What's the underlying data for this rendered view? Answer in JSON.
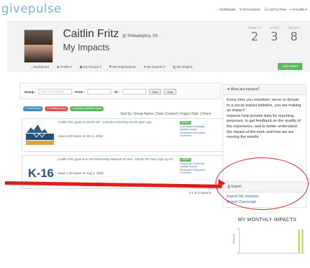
{
  "app": {
    "logo": "givepulse"
  },
  "topnav": {
    "items": [
      {
        "icon": "home-icon",
        "label": "Dashboard"
      },
      {
        "icon": "search-icon",
        "label": "Get Involved"
      },
      {
        "icon": "list-icon",
        "label": "List For Free"
      },
      {
        "icon": "avatar",
        "label": "Hi Caitlin"
      }
    ]
  },
  "profile": {
    "name": "Caitlin Fritz",
    "location": "@ Philadelphia, PA",
    "subtitle": "My Impacts"
  },
  "stats": [
    {
      "label": "IMPACTS",
      "value": "2"
    },
    {
      "label": "HOURS",
      "value": "3"
    },
    {
      "label": "GROUPS",
      "value": "8"
    }
  ],
  "nav": {
    "items": [
      "Dashboard",
      "Profile",
      "My Groups",
      "My Registrations",
      "My Impacts",
      "My Insights"
    ],
    "add_impact": "Add Impact"
  },
  "filter": {
    "group_label": "Group :",
    "group_placeholder": "Select Some Options",
    "from_label": "From :",
    "to_label": "To :",
    "filter_button": "Filter",
    "clear_button": "Clear"
  },
  "badges": [
    {
      "label": "3 Total Hours",
      "color": "#3a8fc0"
    },
    {
      "label": "0 Verified Hours",
      "color": "#d9534f"
    },
    {
      "label": "3 Network Verified Hours",
      "color": "#5cb85c"
    }
  ],
  "sort": {
    "text": "Sort by: Group Name | Date Created | Impact Date | Hours"
  },
  "impacts": [
    {
      "title": "Caitlin Fritz gave to GEAR UP - LaSalle University at test open opp",
      "given": "Gave 2.00 hours on Oct 4, 2016",
      "verified": "Verified",
      "actions": [
        "Download Certificate",
        "Update Impact",
        "Verification Requests",
        "Comment"
      ]
    },
    {
      "title": "Caitlin Fritz gave to K-16 Partnership Network at Test - GEAR UP Tutor Sign up #2",
      "given": "Gave 1.00 hours on Aug 2, 2016",
      "verified": "Verified",
      "actions": [
        "Download Certificate",
        "Update Impact",
        "Verification Requests",
        "Comment"
      ]
    }
  ],
  "pager": "1-2 of 2 impacts",
  "sidebar": {
    "what_title": "What are impacts?",
    "what_body_1": "Every time you volunteer, serve or donate to a social impact initiative, you are making an impact!",
    "what_body_2": "Impacts help provide data for reporting purposes, to get feedback on the quality of the experience, and to better understand the impact of the work and how we are moving the needle.",
    "export_title": "Export",
    "export_links": [
      "Export My Impacts",
      "Export Transcript"
    ],
    "chart_title": "MY MONTHLY IMPACTS",
    "chart_ylabel": "Impacts"
  },
  "colors": {
    "accent_red": "#e21b1b",
    "link": "#3a6fa8",
    "green": "#5cb85c"
  }
}
